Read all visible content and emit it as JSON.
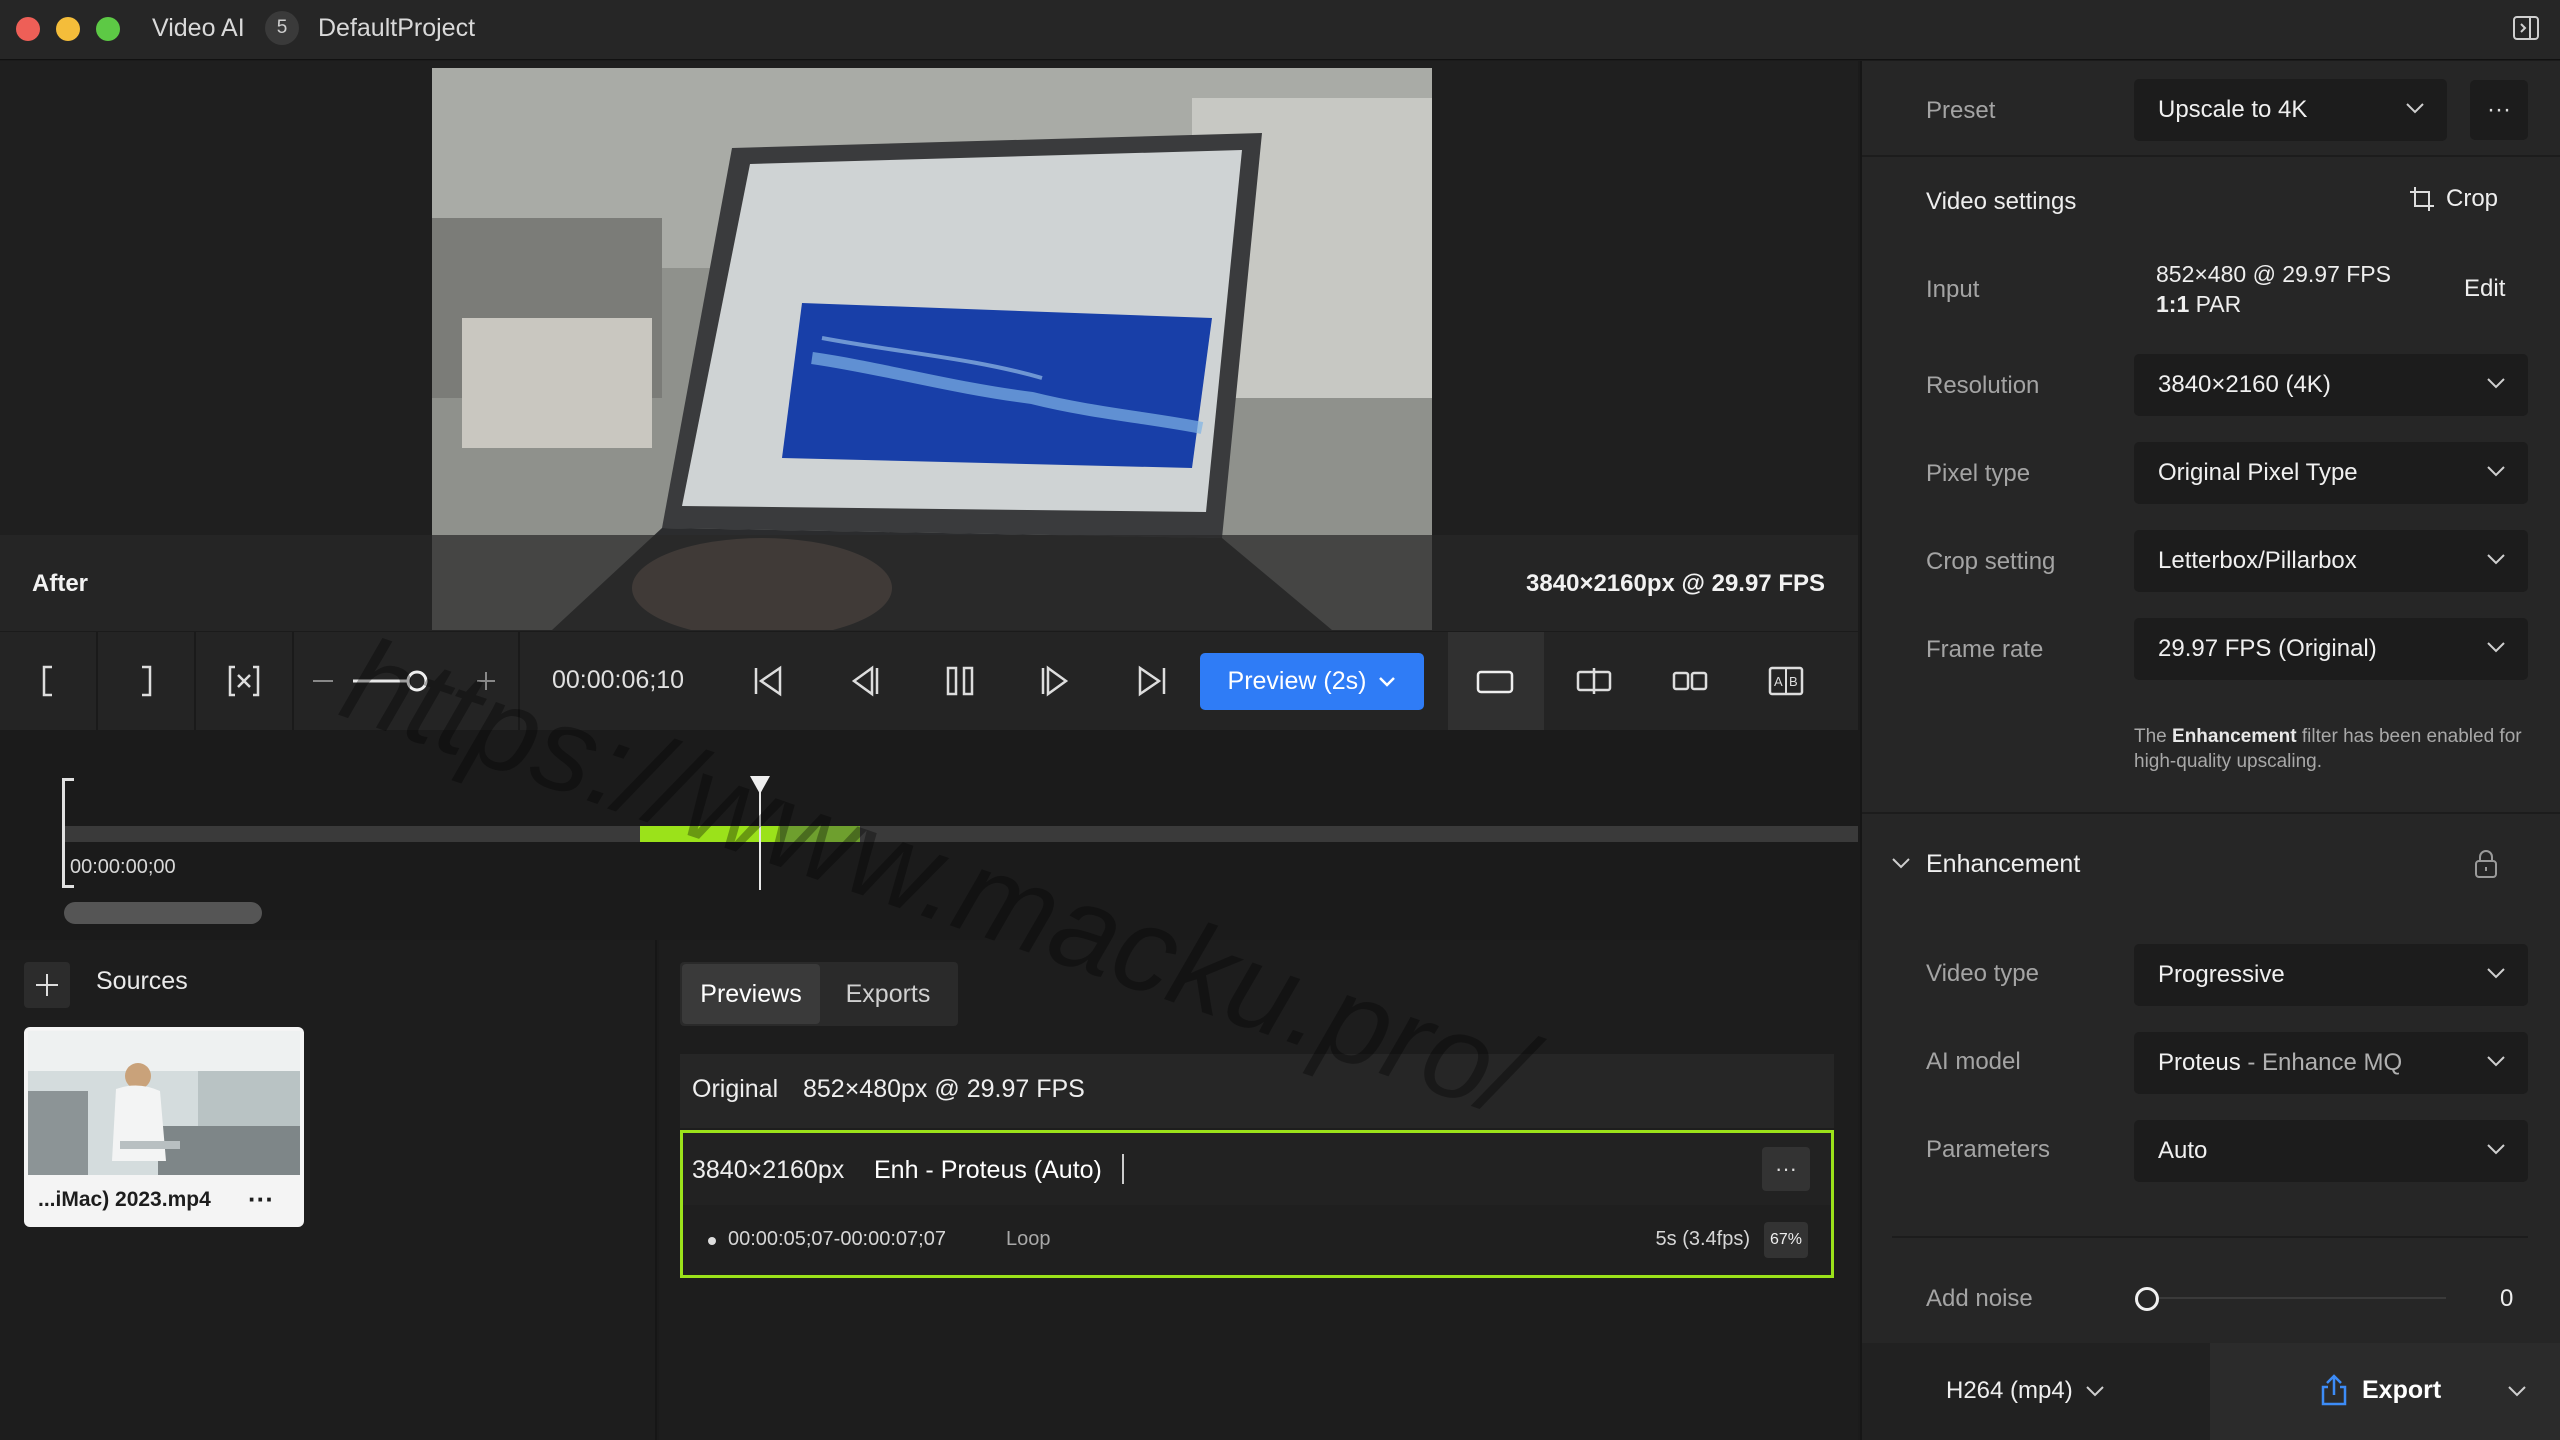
{
  "app": {
    "title": "Video AI",
    "project_count": "5",
    "project_name": "DefaultProject"
  },
  "preview": {
    "mode_label": "After",
    "output_spec": "3840×2160px @ 29.97 FPS"
  },
  "controls": {
    "timecode": "00:00:06;10",
    "preview_button": "Preview (2s)"
  },
  "timeline": {
    "start_time": "00:00:00;00",
    "preview_range_fraction": [
      0.32,
      0.39
    ]
  },
  "sources": {
    "title": "Sources",
    "items": [
      {
        "name": "...iMac) 2023.mp4",
        "more": "···"
      }
    ]
  },
  "previews_panel": {
    "tabs": [
      "Previews",
      "Exports"
    ],
    "original": {
      "label": "Original",
      "spec": "852×480px @ 29.97 FPS"
    },
    "enhanced": {
      "resolution": "3840×2160px",
      "model": "Enh - Proteus (Auto)",
      "more": "···",
      "range": "00:00:05;07-00:00:07;07",
      "loop": "Loop",
      "duration": "5s (3.4fps)",
      "progress": "67%"
    }
  },
  "settings": {
    "preset_label": "Preset",
    "preset_value": "Upscale to 4K",
    "preset_more": "···",
    "video_settings_title": "Video settings",
    "crop_label": "Crop",
    "input_label": "Input",
    "input_spec": "852×480 @ 29.97 FPS",
    "input_par_bold": "1:1",
    "input_par_rest": " PAR",
    "edit_label": "Edit",
    "resolution_label": "Resolution",
    "resolution_value": "3840×2160 (4K)",
    "pixel_type_label": "Pixel type",
    "pixel_type_value": "Original Pixel Type",
    "crop_setting_label": "Crop setting",
    "crop_setting_value": "Letterbox/Pillarbox",
    "frame_rate_label": "Frame rate",
    "frame_rate_value": "29.97 FPS (Original)",
    "note_pre": "The ",
    "note_bold": "Enhancement",
    "note_post": " filter has been enabled for high-quality upscaling.",
    "enhancement_title": "Enhancement",
    "video_type_label": "Video type",
    "video_type_value": "Progressive",
    "ai_model_label": "AI model",
    "ai_model_value": "Proteus",
    "ai_model_sub": " - Enhance MQ",
    "parameters_label": "Parameters",
    "parameters_value": "Auto",
    "add_noise_label": "Add noise",
    "add_noise_value": "0",
    "codec": "H264 (mp4)",
    "export_label": "Export"
  },
  "watermark": "https://www.macku.pro/",
  "colors": {
    "accent_blue": "#2f7cf6",
    "preview_green": "#9be21a",
    "panel_bg": "#262626"
  }
}
